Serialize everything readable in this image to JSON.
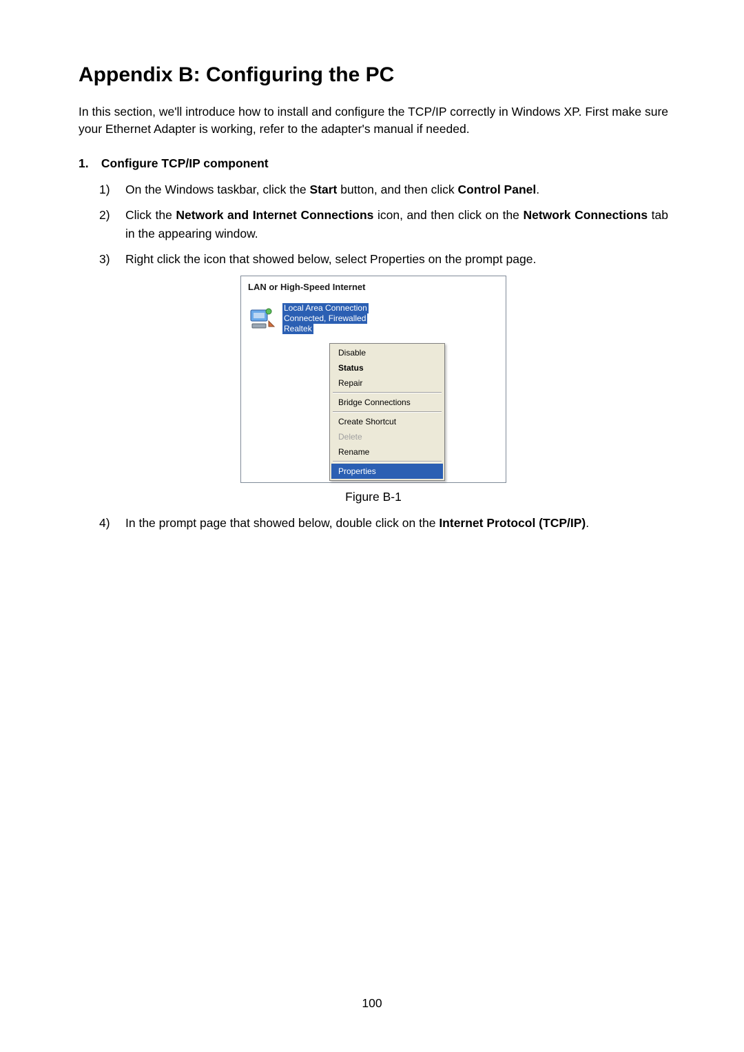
{
  "title": "Appendix B: Configuring the PC",
  "intro": "In this section, we'll introduce how to install and configure the TCP/IP correctly in Windows XP. First make sure your Ethernet Adapter is working, refer to the adapter's manual if needed.",
  "section": {
    "number": "1.",
    "title": "Configure TCP/IP component"
  },
  "steps": {
    "1": {
      "num": "1)",
      "pre": "On the Windows taskbar, click the ",
      "b1": "Start",
      "mid": " button, and then click ",
      "b2": "Control Panel",
      "post": "."
    },
    "2": {
      "num": "2)",
      "pre": "Click the ",
      "b1": "Network and Internet Connections",
      "mid": " icon, and then click on the ",
      "b2": "Network Connections",
      "post": " tab in the appearing window."
    },
    "3": {
      "num": "3)",
      "text": "Right click the icon that showed below, select Properties on the prompt page."
    },
    "4": {
      "num": "4)",
      "pre": "In the prompt page that showed below, double click on the ",
      "b1": "Internet Protocol (TCP/IP)",
      "post": "."
    }
  },
  "figure": {
    "panel_title": "LAN or High-Speed Internet",
    "connection": {
      "line1": "Local Area Connection",
      "line2": "Connected, Firewalled",
      "line3": "Realtek"
    },
    "menu": {
      "disable": "Disable",
      "status": "Status",
      "repair": "Repair",
      "bridge": "Bridge Connections",
      "shortcut": "Create Shortcut",
      "delete": "Delete",
      "rename": "Rename",
      "properties": "Properties"
    },
    "caption": "Figure B-1"
  },
  "page_number": "100"
}
